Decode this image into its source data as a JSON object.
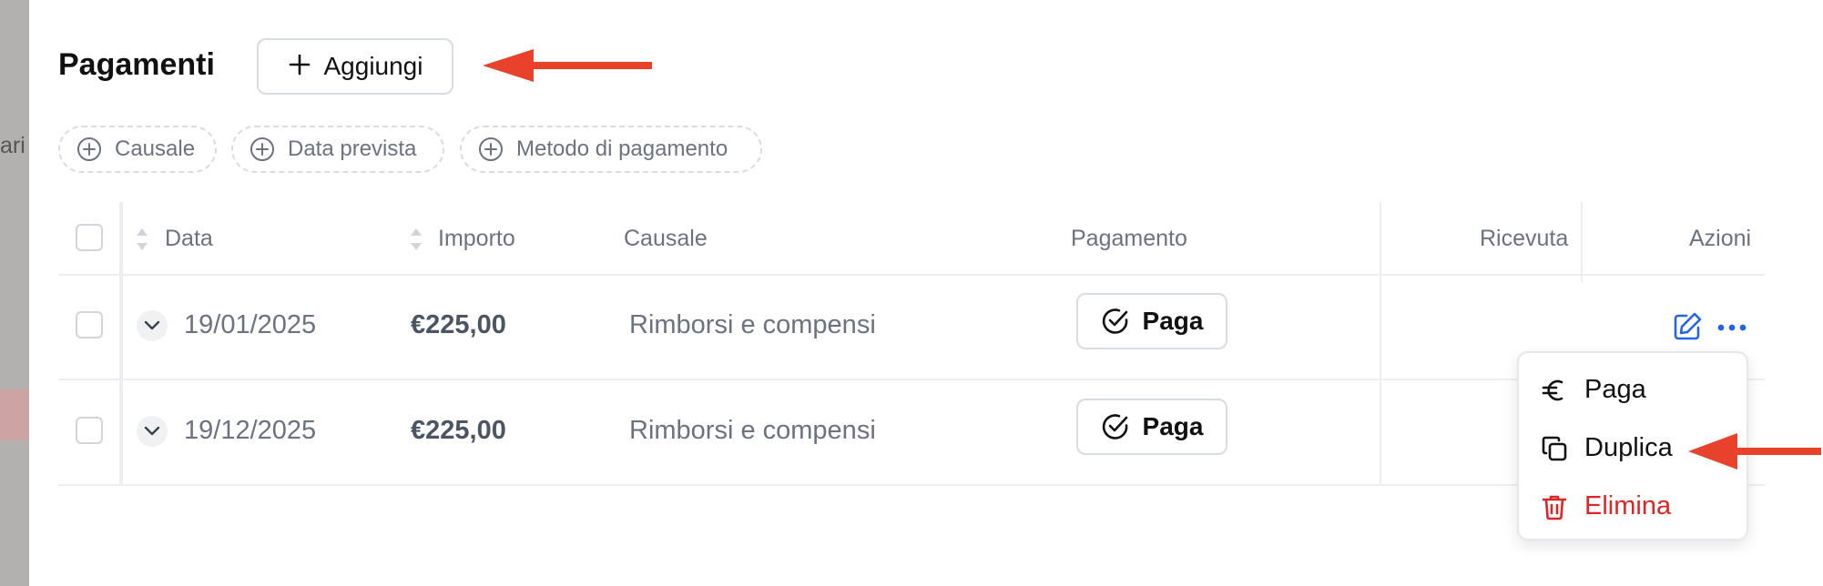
{
  "backdrop": {
    "fragment": "ari"
  },
  "header": {
    "title": "Pagamenti",
    "add_label": "Aggiungi"
  },
  "filters": [
    {
      "label": "Causale"
    },
    {
      "label": "Data prevista"
    },
    {
      "label": "Metodo di pagamento"
    }
  ],
  "table": {
    "columns": {
      "data": "Data",
      "importo": "Importo",
      "causale": "Causale",
      "pagamento": "Pagamento",
      "ricevuta": "Ricevuta",
      "azioni": "Azioni"
    },
    "rows": [
      {
        "data": "19/01/2025",
        "importo": "€225,00",
        "causale": "Rimborsi e compensi",
        "pay_label": "Paga"
      },
      {
        "data": "19/12/2025",
        "importo": "€225,00",
        "causale": "Rimborsi e compensi",
        "pay_label": "Paga"
      }
    ]
  },
  "action_menu": {
    "items": [
      {
        "label": "Paga",
        "icon": "euro-icon"
      },
      {
        "label": "Duplica",
        "icon": "copy-icon"
      },
      {
        "label": "Elimina",
        "icon": "trash-icon"
      }
    ]
  },
  "colors": {
    "annotation_arrow": "#e8412c",
    "danger": "#dc2626",
    "edit_icon": "#2563eb"
  }
}
